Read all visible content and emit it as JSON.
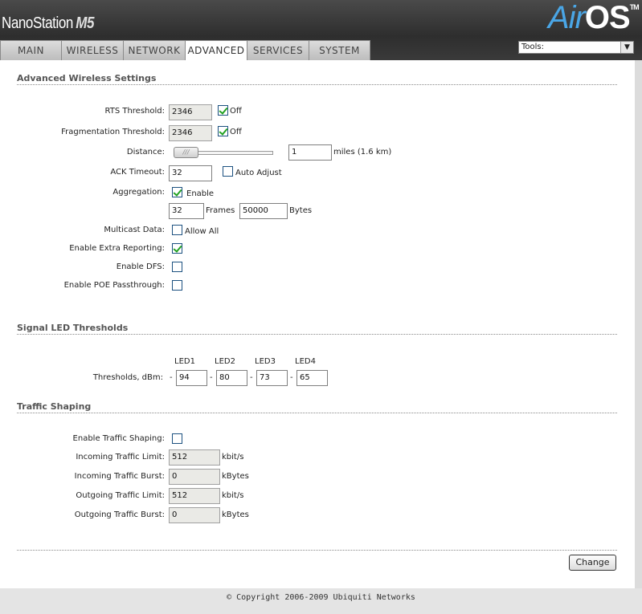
{
  "brand": {
    "name": "NanoStation",
    "model": "M5"
  },
  "logo": {
    "air": "Air",
    "os": "OS",
    "tm": "TM"
  },
  "tabs": [
    {
      "label": "MAIN"
    },
    {
      "label": "WIRELESS"
    },
    {
      "label": "NETWORK"
    },
    {
      "label": "ADVANCED",
      "active": true
    },
    {
      "label": "SERVICES"
    },
    {
      "label": "SYSTEM"
    }
  ],
  "tools": {
    "value": "Tools:"
  },
  "advanced": {
    "title": "Advanced Wireless Settings",
    "rts_label": "RTS Threshold:",
    "rts_value": "2346",
    "rts_off_label": "Off",
    "rts_off_checked": true,
    "frag_label": "Fragmentation Threshold:",
    "frag_value": "2346",
    "frag_off_label": "Off",
    "frag_off_checked": true,
    "distance_label": "Distance:",
    "distance_value": "1",
    "distance_unit": "miles (1.6 km)",
    "ack_label": "ACK Timeout:",
    "ack_value": "32",
    "auto_adjust_label": "Auto Adjust",
    "auto_adjust_checked": false,
    "aggregation_label": "Aggregation:",
    "aggregation_enable_label": "Enable",
    "aggregation_checked": true,
    "frames_value": "32",
    "frames_label": "Frames",
    "bytes_value": "50000",
    "bytes_label": "Bytes",
    "multicast_label": "Multicast Data:",
    "allow_all_label": "Allow All",
    "multicast_checked": false,
    "extra_reporting_label": "Enable Extra Reporting:",
    "extra_reporting_checked": true,
    "dfs_label": "Enable DFS:",
    "dfs_checked": false,
    "poe_label": "Enable POE Passthrough:",
    "poe_checked": false
  },
  "signal_led": {
    "title": "Signal LED Thresholds",
    "headers": [
      "LED1",
      "LED2",
      "LED3",
      "LED4"
    ],
    "label": "Thresholds, dBm:",
    "values": [
      "94",
      "80",
      "73",
      "65"
    ],
    "sep": "-"
  },
  "traffic": {
    "title": "Traffic Shaping",
    "enable_label": "Enable Traffic Shaping:",
    "enable_checked": false,
    "in_limit_label": "Incoming Traffic Limit:",
    "in_limit_value": "512",
    "in_limit_unit": "kbit/s",
    "in_burst_label": "Incoming Traffic Burst:",
    "in_burst_value": "0",
    "in_burst_unit": "kBytes",
    "out_limit_label": "Outgoing Traffic Limit:",
    "out_limit_value": "512",
    "out_limit_unit": "kbit/s",
    "out_burst_label": "Outgoing Traffic Burst:",
    "out_burst_value": "0",
    "out_burst_unit": "kBytes"
  },
  "change_button": "Change",
  "footer": {
    "copyright": "© Copyright 2006-2009 Ubiquiti Networks"
  }
}
